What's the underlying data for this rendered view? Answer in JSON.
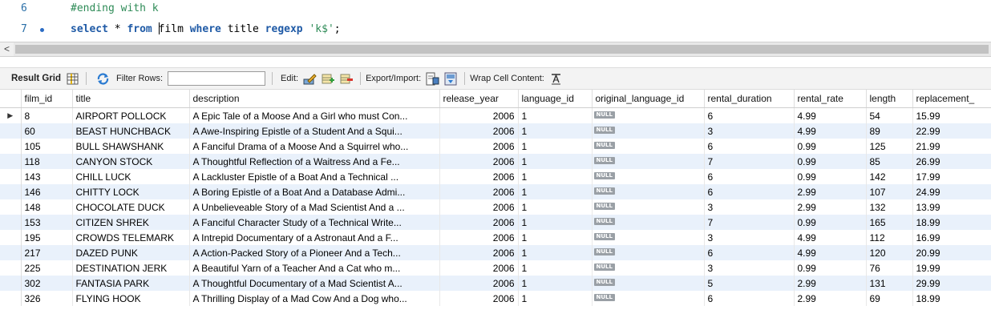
{
  "editor": {
    "lines": [
      {
        "number": "6",
        "text": "#ending with k"
      },
      {
        "number": "7",
        "kw1": "select",
        "p1": " * ",
        "kw2": "from",
        "p2a": " ",
        "p2b": "film",
        "p3": " ",
        "kw3": "where",
        "p4": " title ",
        "kw4": "regexp",
        "p5": " ",
        "str": "'k$'",
        "p6": ";"
      }
    ]
  },
  "scrollbar": {
    "left_arrow": "<"
  },
  "toolbar": {
    "result_grid": "Result Grid",
    "filter_rows": "Filter Rows:",
    "filter_value": "",
    "edit": "Edit:",
    "export_import": "Export/Import:",
    "wrap_cell": "Wrap Cell Content:"
  },
  "grid": {
    "columns": [
      "film_id",
      "title",
      "description",
      "release_year",
      "language_id",
      "original_language_id",
      "rental_duration",
      "rental_rate",
      "length",
      "replacement_"
    ],
    "null_label": "NULL",
    "rows": [
      {
        "film_id": "8",
        "title": "AIRPORT POLLOCK",
        "description": "A Epic Tale of a Moose And a Girl who must Con...",
        "release_year": "2006",
        "language_id": "1",
        "rental_duration": "6",
        "rental_rate": "4.99",
        "length": "54",
        "replacement": "15.99"
      },
      {
        "film_id": "60",
        "title": "BEAST HUNCHBACK",
        "description": "A Awe-Inspiring Epistle of a Student And a Squi...",
        "release_year": "2006",
        "language_id": "1",
        "rental_duration": "3",
        "rental_rate": "4.99",
        "length": "89",
        "replacement": "22.99"
      },
      {
        "film_id": "105",
        "title": "BULL SHAWSHANK",
        "description": "A Fanciful Drama of a Moose And a Squirrel who...",
        "release_year": "2006",
        "language_id": "1",
        "rental_duration": "6",
        "rental_rate": "0.99",
        "length": "125",
        "replacement": "21.99"
      },
      {
        "film_id": "118",
        "title": "CANYON STOCK",
        "description": "A Thoughtful Reflection of a Waitress And a Fe...",
        "release_year": "2006",
        "language_id": "1",
        "rental_duration": "7",
        "rental_rate": "0.99",
        "length": "85",
        "replacement": "26.99"
      },
      {
        "film_id": "143",
        "title": "CHILL LUCK",
        "description": "A Lackluster Epistle of a Boat And a Technical ...",
        "release_year": "2006",
        "language_id": "1",
        "rental_duration": "6",
        "rental_rate": "0.99",
        "length": "142",
        "replacement": "17.99"
      },
      {
        "film_id": "146",
        "title": "CHITTY LOCK",
        "description": "A Boring Epistle of a Boat And a Database Admi...",
        "release_year": "2006",
        "language_id": "1",
        "rental_duration": "6",
        "rental_rate": "2.99",
        "length": "107",
        "replacement": "24.99"
      },
      {
        "film_id": "148",
        "title": "CHOCOLATE DUCK",
        "description": "A Unbelieveable Story of a Mad Scientist And a ...",
        "release_year": "2006",
        "language_id": "1",
        "rental_duration": "3",
        "rental_rate": "2.99",
        "length": "132",
        "replacement": "13.99"
      },
      {
        "film_id": "153",
        "title": "CITIZEN SHREK",
        "description": "A Fanciful Character Study of a Technical Write...",
        "release_year": "2006",
        "language_id": "1",
        "rental_duration": "7",
        "rental_rate": "0.99",
        "length": "165",
        "replacement": "18.99"
      },
      {
        "film_id": "195",
        "title": "CROWDS TELEMARK",
        "description": "A Intrepid Documentary of a Astronaut And a F...",
        "release_year": "2006",
        "language_id": "1",
        "rental_duration": "3",
        "rental_rate": "4.99",
        "length": "112",
        "replacement": "16.99"
      },
      {
        "film_id": "217",
        "title": "DAZED PUNK",
        "description": "A Action-Packed Story of a Pioneer And a Tech...",
        "release_year": "2006",
        "language_id": "1",
        "rental_duration": "6",
        "rental_rate": "4.99",
        "length": "120",
        "replacement": "20.99"
      },
      {
        "film_id": "225",
        "title": "DESTINATION JERK",
        "description": "A Beautiful Yarn of a Teacher And a Cat who m...",
        "release_year": "2006",
        "language_id": "1",
        "rental_duration": "3",
        "rental_rate": "0.99",
        "length": "76",
        "replacement": "19.99"
      },
      {
        "film_id": "302",
        "title": "FANTASIA PARK",
        "description": "A Thoughtful Documentary of a Mad Scientist A...",
        "release_year": "2006",
        "language_id": "1",
        "rental_duration": "5",
        "rental_rate": "2.99",
        "length": "131",
        "replacement": "29.99"
      },
      {
        "film_id": "326",
        "title": "FLYING HOOK",
        "description": "A Thrilling Display of a Mad Cow And a Dog who...",
        "release_year": "2006",
        "language_id": "1",
        "rental_duration": "6",
        "rental_rate": "2.99",
        "length": "69",
        "replacement": "18.99"
      }
    ]
  }
}
